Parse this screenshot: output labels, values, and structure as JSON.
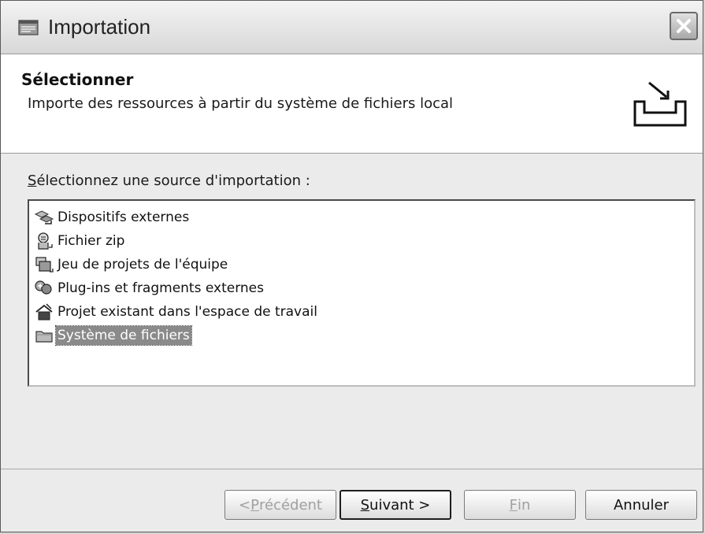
{
  "window": {
    "title": "Importation"
  },
  "banner": {
    "title": "Sélectionner",
    "description": "Importe des ressources à partir du système de fichiers local"
  },
  "main": {
    "source_label_mnemonic": "S",
    "source_label_rest": "électionnez une source d'importation :"
  },
  "sources": [
    {
      "label": "Dispositifs externes",
      "icon": "external-devices-icon",
      "selected": false
    },
    {
      "label": "Fichier zip",
      "icon": "zip-file-icon",
      "selected": false
    },
    {
      "label": "Jeu de projets de l'équipe",
      "icon": "team-project-set-icon",
      "selected": false
    },
    {
      "label": "Plug-ins et fragments externes",
      "icon": "plugins-fragments-icon",
      "selected": false
    },
    {
      "label": "Projet existant dans l'espace de travail",
      "icon": "existing-project-icon",
      "selected": false
    },
    {
      "label": "Système de fichiers",
      "icon": "file-system-icon",
      "selected": true
    }
  ],
  "buttons": {
    "back_prefix": "< ",
    "back_mnemonic": "P",
    "back_rest": "récédent",
    "next_mnemonic": "S",
    "next_rest": "uivant >",
    "finish_mnemonic": "F",
    "finish_rest": "in",
    "cancel": "Annuler"
  }
}
